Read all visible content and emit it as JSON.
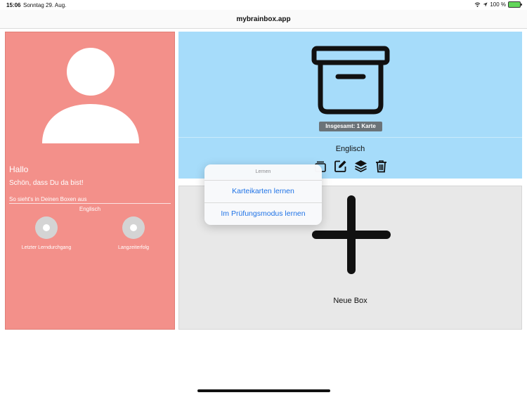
{
  "status_bar": {
    "time": "15:06",
    "date": "Sonntag 29. Aug.",
    "battery": "100 %"
  },
  "browser": {
    "url": "mybrainbox.app"
  },
  "profile": {
    "greeting": "Hallo",
    "subtitle": "Schön, dass Du da bist!",
    "boxes_heading": "So sieht's in Deinen Boxen aus",
    "language": "Englisch",
    "stats": [
      {
        "label": "Letzter Lerndurchgang"
      },
      {
        "label": "Langzeiterfolg"
      }
    ],
    "colors": {
      "background": "#f3908a"
    }
  },
  "box": {
    "icon": "archive-box-icon",
    "badge": "Insgesamt: 1 Karte",
    "name": "Englisch",
    "actions": [
      "cards-stack-icon",
      "edit-icon",
      "layers-icon",
      "trash-icon"
    ],
    "colors": {
      "background": "#a6dcfa"
    }
  },
  "new_box": {
    "icon": "plus-icon",
    "label": "Neue Box"
  },
  "popover": {
    "title": "Lernen",
    "options": [
      "Karteikarten lernen",
      "Im Prüfungsmodus lernen"
    ],
    "colors": {
      "link": "#1f73e6"
    }
  }
}
